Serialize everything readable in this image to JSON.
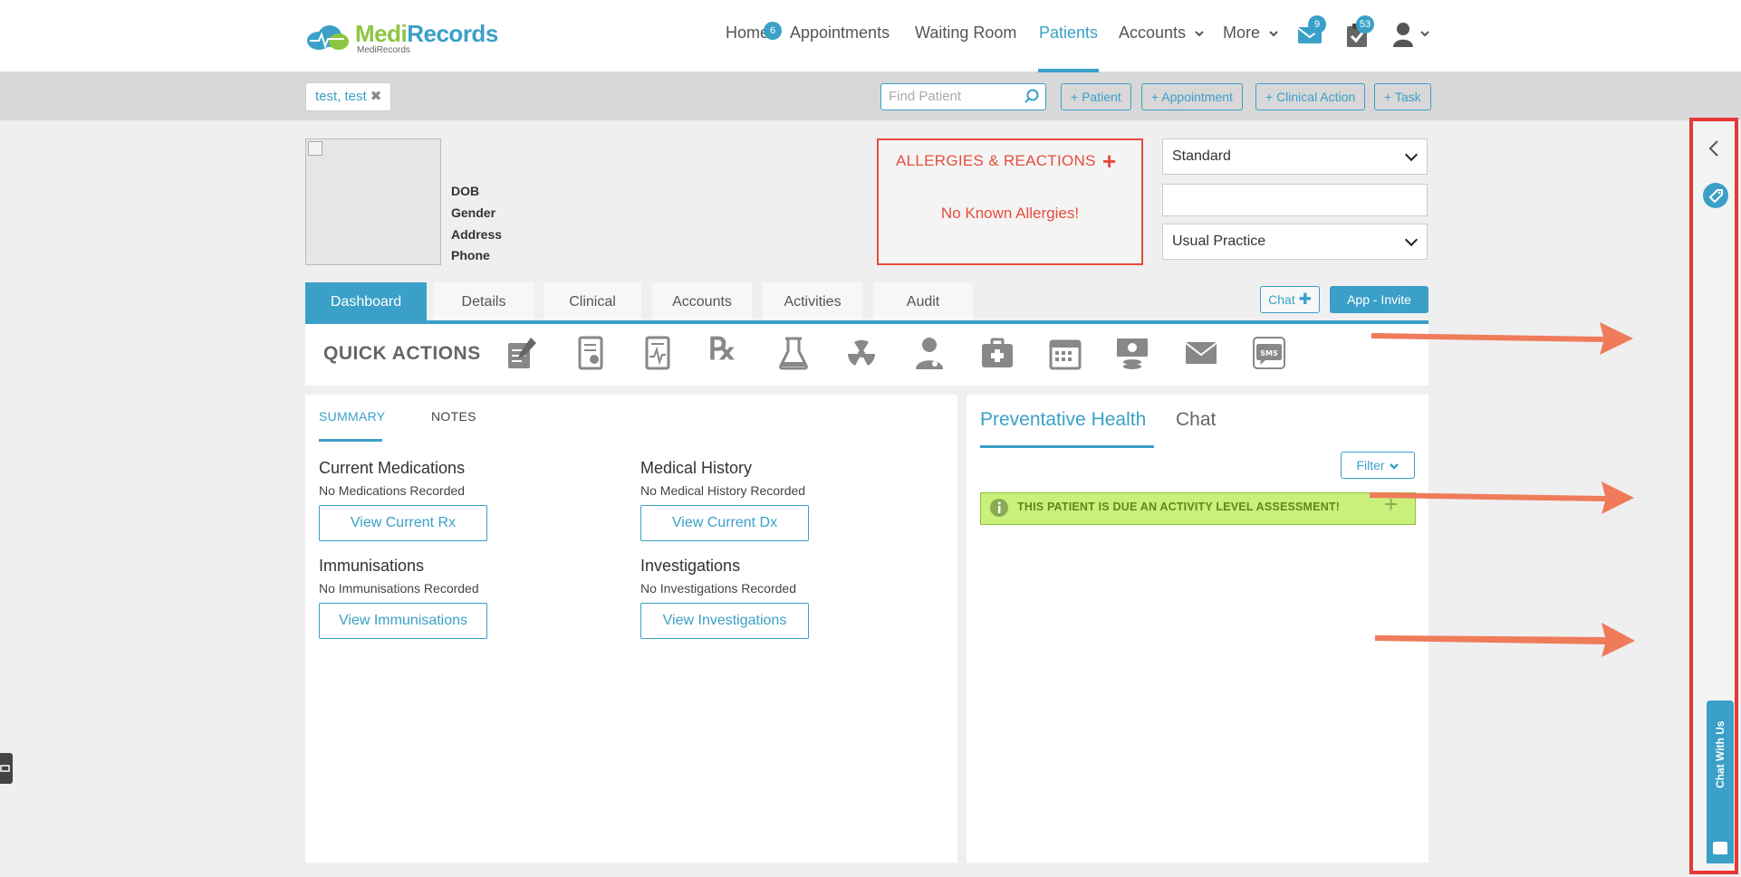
{
  "brand": {
    "name_part1": "Medi",
    "name_part2": "Records",
    "subtitle": "MediRecords"
  },
  "nav": {
    "home": "Home",
    "home_badge": "6",
    "appointments": "Appointments",
    "waiting_room": "Waiting Room",
    "patients": "Patients",
    "accounts": "Accounts",
    "more": "More",
    "mail_badge": "9",
    "tasks_badge": "53"
  },
  "secondary": {
    "patient_tag": "test, test",
    "find_placeholder": "Find Patient",
    "add_patient": "+ Patient",
    "add_appointment": "+ Appointment",
    "add_clinical_action": "+ Clinical Action",
    "add_task": "+ Task"
  },
  "patient": {
    "dob_label": "DOB",
    "gender_label": "Gender",
    "address_label": "Address",
    "phone_label": "Phone"
  },
  "allergies": {
    "title": "ALLERGIES & REACTIONS",
    "plus": "+",
    "none": "No Known Allergies!"
  },
  "selects": {
    "billing": "Standard",
    "middle": "",
    "practice": "Usual Practice"
  },
  "tabs": [
    "Dashboard",
    "Details",
    "Clinical",
    "Accounts",
    "Activities",
    "Audit"
  ],
  "actions": {
    "chat": "Chat",
    "app_invite": "App - Invite"
  },
  "quick_actions": {
    "title": "QUICK ACTIONS",
    "icons": [
      "notes-icon",
      "certificate-icon",
      "health-summary-icon",
      "prescription-icon",
      "pathology-icon",
      "radiology-icon",
      "referral-doctor-icon",
      "medical-kit-icon",
      "calendar-icon",
      "billing-icon",
      "mail-icon",
      "sms-icon"
    ]
  },
  "summary": {
    "tab_summary": "SUMMARY",
    "tab_notes": "NOTES",
    "sections": [
      {
        "title": "Current Medications",
        "note": "No Medications Recorded",
        "button": "View Current Rx"
      },
      {
        "title": "Medical History",
        "note": "No Medical History Recorded",
        "button": "View Current Dx"
      },
      {
        "title": "Immunisations",
        "note": "No Immunisations Recorded",
        "button": "View Immunisations"
      },
      {
        "title": "Investigations",
        "note": "No Investigations Recorded",
        "button": "View Investigations"
      }
    ]
  },
  "right": {
    "tab_preventative": "Preventative Health",
    "tab_chat": "Chat",
    "filter": "Filter",
    "alert": "THIS PATIENT IS DUE AN ACTIVITY LEVEL ASSESSMENT!"
  },
  "sidebar": {
    "chat_with_us": "Chat With Us"
  },
  "colors": {
    "accent": "#3aa0c8",
    "danger": "#e74c3c",
    "arrow": "#ef7b5a",
    "highlight": "#e53935",
    "alert_bg": "#c8f07a"
  }
}
